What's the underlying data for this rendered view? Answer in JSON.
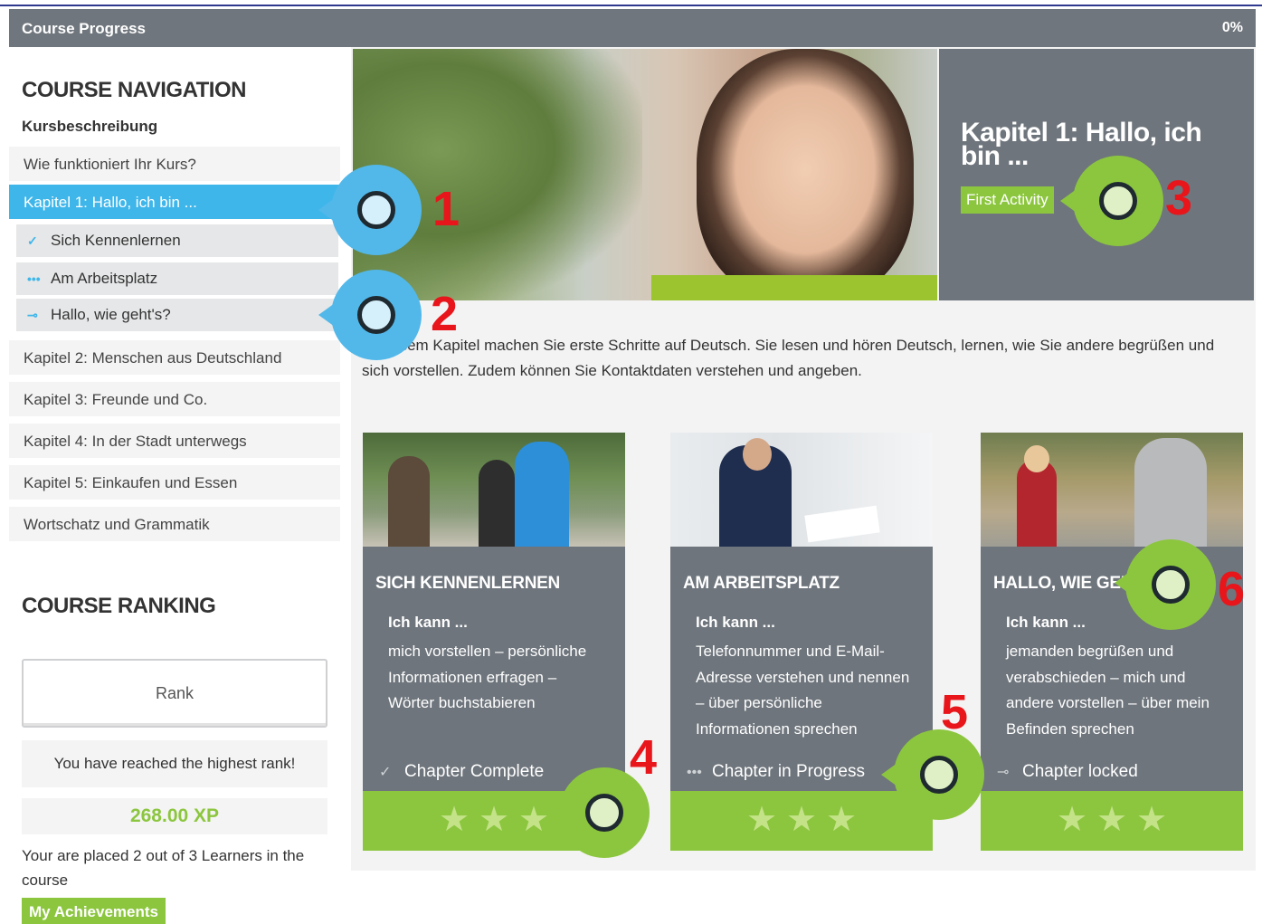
{
  "progress": {
    "label": "Course Progress",
    "percent_text": "0%",
    "percent_value": 0
  },
  "nav": {
    "heading": "COURSE NAVIGATION",
    "subheading": "Kursbeschreibung",
    "items": [
      {
        "label": "Wie funktioniert Ihr Kurs?",
        "active": false
      },
      {
        "label": "Kapitel 1: Hallo, ich bin ...",
        "active": true
      }
    ],
    "subitems": [
      {
        "label": "Sich Kennenlernen",
        "icon": "check-icon",
        "glyph": "✓"
      },
      {
        "label": "Am Arbeitsplatz",
        "icon": "in-progress-dots-icon",
        "glyph": "•••"
      },
      {
        "label": "Hallo, wie geht's?",
        "icon": "locked-key-icon",
        "glyph": "⊸"
      }
    ],
    "chapters": [
      "Kapitel 2: Menschen aus Deutschland",
      "Kapitel 3: Freunde und Co.",
      "Kapitel 4: In der Stadt unterwegs",
      "Kapitel 5: Einkaufen und Essen",
      "Wortschatz und Grammatik"
    ]
  },
  "ranking": {
    "heading": "COURSE RANKING",
    "rank_button": "Rank",
    "message": "You have reached the highest rank!",
    "xp": "268.00 XP",
    "placement": "Your are placed 2 out of 3 Learners in the course",
    "achievements_button": "My Achievements"
  },
  "hero": {
    "title": "Kapitel 1: Hallo, ich bin ...",
    "button": "First Activity"
  },
  "intro": "In diesem Kapitel machen Sie erste Schritte auf Deutsch. Sie lesen und hören Deutsch, lernen, wie Sie andere begrüßen und sich vorstellen. Zudem können Sie Kontaktdaten verstehen und angeben.",
  "cards": [
    {
      "title": "SICH KENNENLERNEN",
      "ich": "Ich kann ...",
      "desc": "mich vorstellen – persönliche Informationen erfragen – Wörter buchstabieren",
      "status": "Chapter Complete",
      "status_icon": "check-icon",
      "status_glyph": "✓",
      "stars": 3
    },
    {
      "title": "AM ARBEITSPLATZ",
      "ich": "Ich kann ...",
      "desc": "Telefonnummer und E-Mail-Adresse verstehen und nennen – über persönliche Informationen sprechen",
      "status": "Chapter in Progress",
      "status_icon": "in-progress-dots-icon",
      "status_glyph": "•••",
      "stars": 3
    },
    {
      "title": "HALLO, WIE GEHT'S?",
      "ich": "Ich kann ...",
      "desc": "jemanden begrüßen und verabschieden – mich und andere vorstellen – über mein Befinden sprechen",
      "status": "Chapter locked",
      "status_icon": "locked-key-icon",
      "status_glyph": "⊸",
      "stars": 3
    }
  ],
  "callouts": [
    "1",
    "2",
    "3",
    "4",
    "5",
    "6"
  ],
  "colors": {
    "accent_blue": "#3fb6ea",
    "accent_green": "#8cc63f",
    "panel_gray": "#6e757c",
    "callout_red": "#e8151b"
  }
}
